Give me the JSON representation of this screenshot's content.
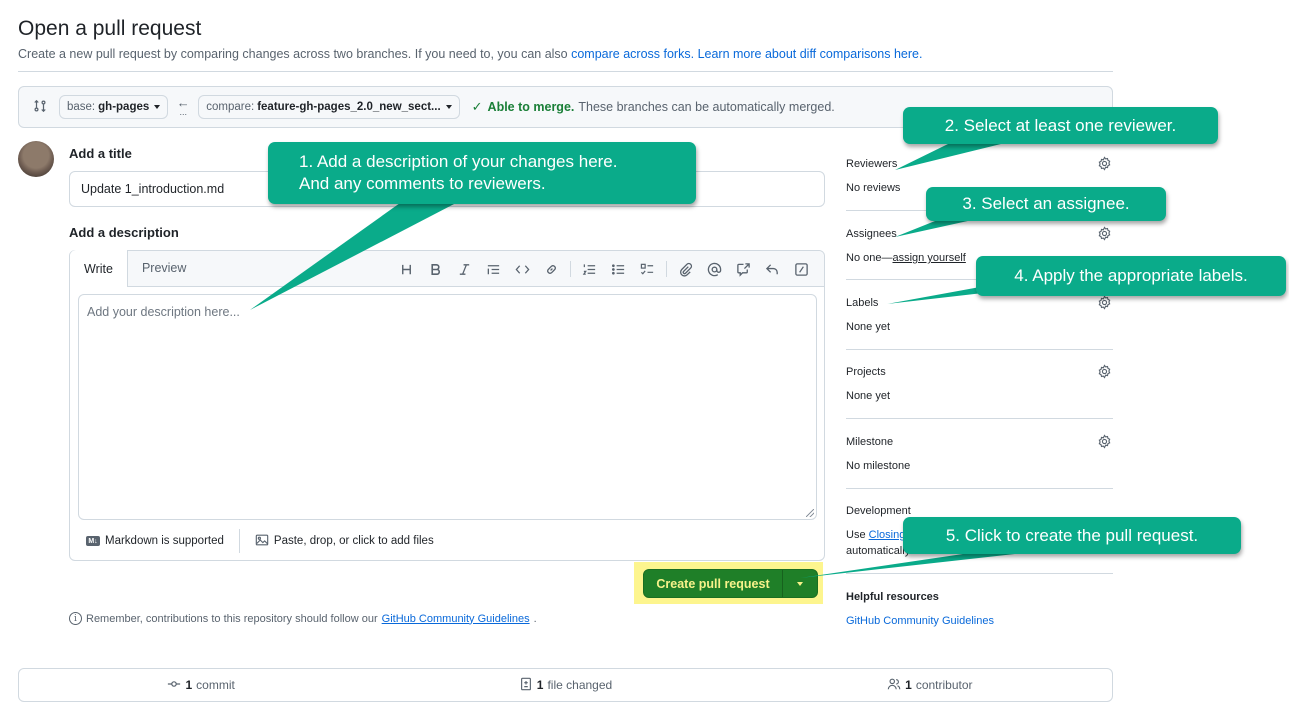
{
  "header": {
    "title": "Open a pull request",
    "subtitle_prefix": "Create a new pull request by comparing changes across two branches. If you need to, you can also ",
    "compare_forks_link": "compare across forks.",
    "learn_more_link": "Learn more about diff comparisons here."
  },
  "range": {
    "base_label": "base:",
    "base_branch": "gh-pages",
    "compare_label": "compare:",
    "compare_branch": "feature-gh-pages_2.0_new_sect...",
    "arrow": "←",
    "arrow_dots": "...",
    "merge_check": "✓",
    "merge_status": "Able to merge.",
    "merge_detail": "These branches can be automatically merged."
  },
  "form": {
    "title_label": "Add a title",
    "title_value": "Update 1_introduction.md",
    "description_label": "Add a description",
    "tabs": [
      {
        "label": "Write",
        "active": true
      },
      {
        "label": "Preview",
        "active": false
      }
    ],
    "toolbar": [
      "heading",
      "bold",
      "italic",
      "quote",
      "code",
      "link",
      "ordered-list",
      "unordered-list",
      "task-list",
      "attach",
      "mention",
      "cross-reference",
      "reply",
      "slash-commands"
    ],
    "description_placeholder": "Add your description here...",
    "markdown_note": "Markdown is supported",
    "markdown_badge": "M↓",
    "attach_note": "Paste, drop, or click to add files",
    "create_button": "Create pull request",
    "remember_prefix": "Remember, contributions to this repository should follow our ",
    "remember_link": "GitHub Community Guidelines",
    "remember_suffix": "."
  },
  "sidebar": {
    "reviewers": {
      "label": "Reviewers",
      "value": "No reviews"
    },
    "assignees": {
      "label": "Assignees",
      "value_prefix": "No one—",
      "value_link": "assign yourself"
    },
    "labels": {
      "label": "Labels",
      "value": "None yet"
    },
    "projects": {
      "label": "Projects",
      "value": "None yet"
    },
    "milestone": {
      "label": "Milestone",
      "value": "No milestone"
    },
    "development": {
      "label": "Development",
      "value_prefix": "Use ",
      "value_link": "Closing",
      "value_line2": "automatically..."
    },
    "helpful": {
      "label": "Helpful resources",
      "link": "GitHub Community Guidelines"
    }
  },
  "callouts": [
    {
      "text_line1": "1. Add a description of your changes here.",
      "text_line2": "And any comments to reviewers."
    },
    {
      "text": "2. Select at least one reviewer."
    },
    {
      "text": "3. Select an assignee."
    },
    {
      "text": "4. Apply the appropriate labels."
    },
    {
      "text": "5. Click to create the pull request."
    }
  ],
  "stats": {
    "commits_count": "1",
    "commits_label": "commit",
    "files_count": "1",
    "files_label": "file changed",
    "contributors_count": "1",
    "contributors_label": "contributor"
  },
  "colors": {
    "callout": "#0aab8a",
    "primary_button": "#1f7f28",
    "highlight": "#fdf58e",
    "link": "#0969da",
    "success": "#1a7f37"
  }
}
